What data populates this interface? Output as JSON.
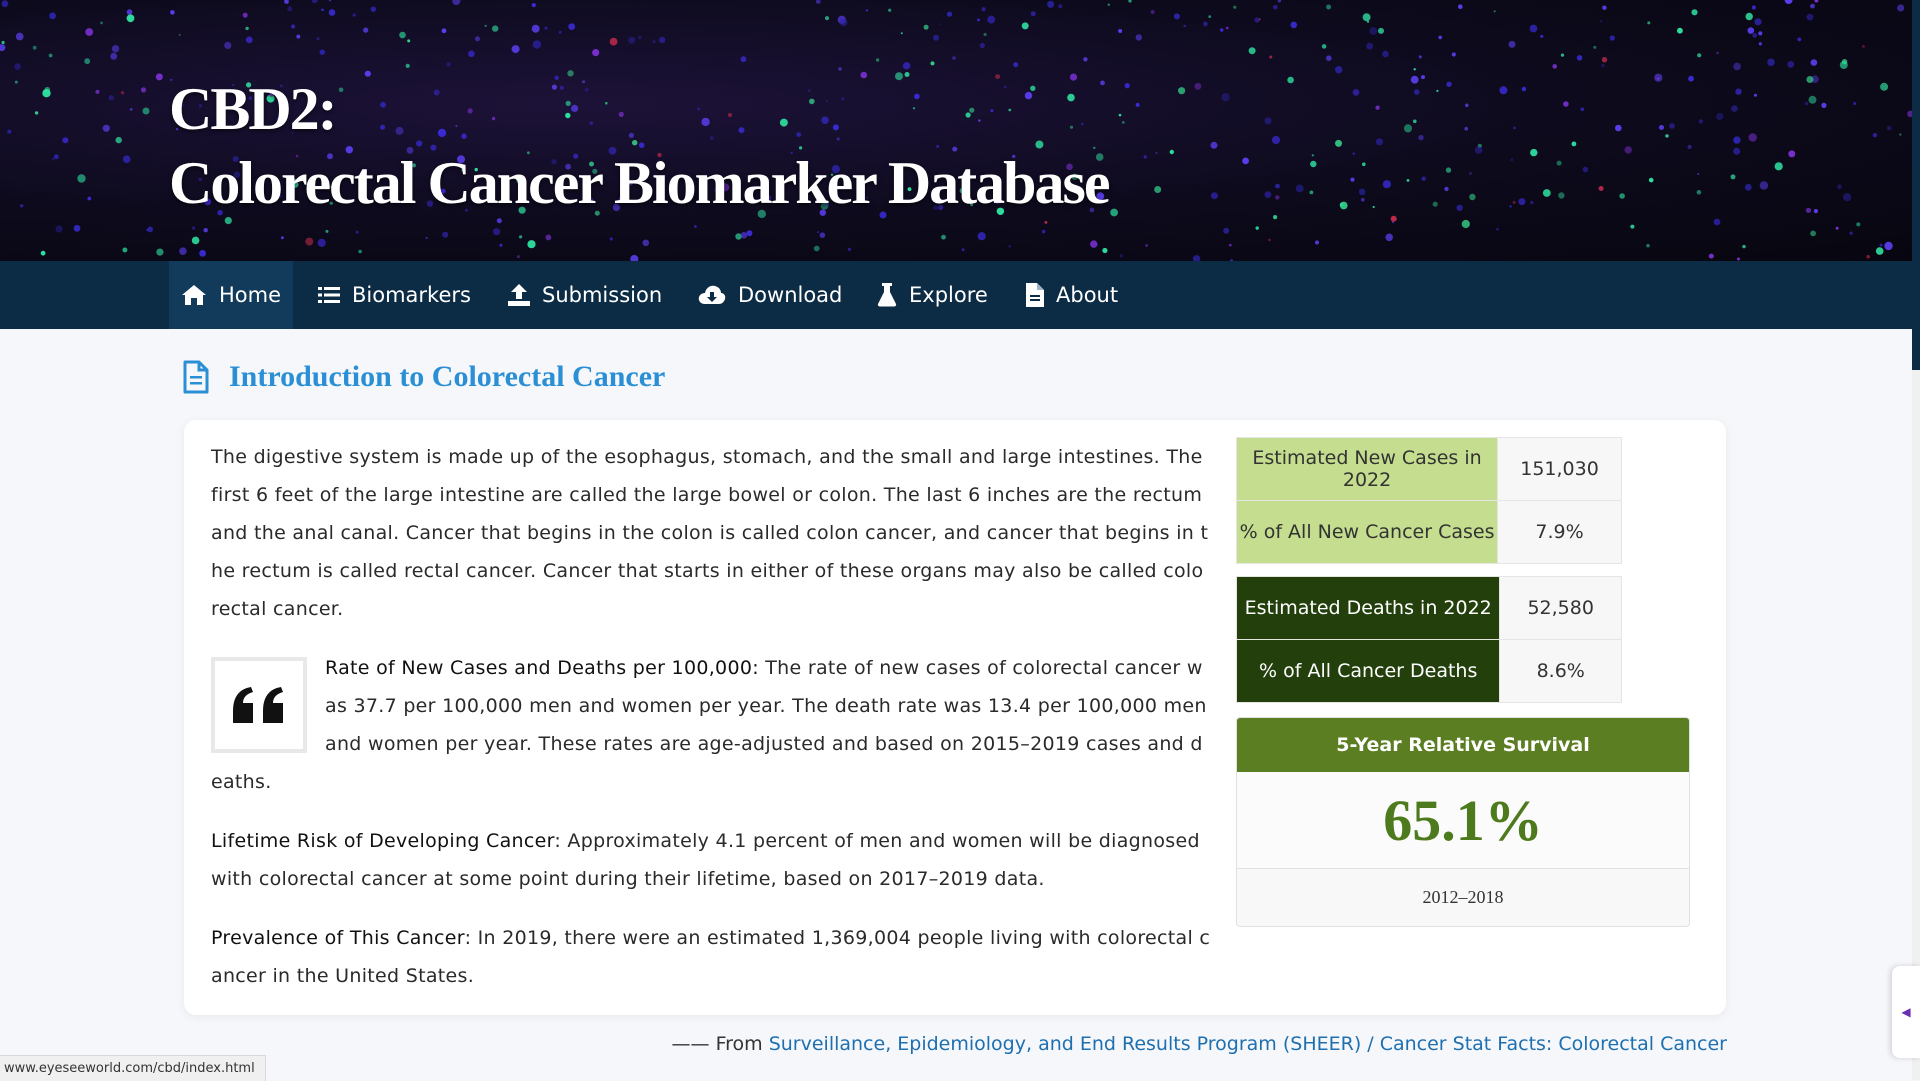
{
  "banner": {
    "title_line1": "CBD2:",
    "title_line2": "Colorectal Cancer Biomarker Database"
  },
  "nav": {
    "items": [
      {
        "label": "Home",
        "icon": "home-icon",
        "active": true
      },
      {
        "label": "Biomarkers",
        "icon": "list-icon"
      },
      {
        "label": "Submission",
        "icon": "upload-icon"
      },
      {
        "label": "Download",
        "icon": "cloud-download-icon"
      },
      {
        "label": "Explore",
        "icon": "flask-icon"
      },
      {
        "label": "About",
        "icon": "document-icon"
      }
    ]
  },
  "section": {
    "title": "Introduction to Colorectal Cancer",
    "icon": "document-outline-icon"
  },
  "intro": {
    "paragraph1": "The digestive system is made up of the esophagus, stomach, and the small and large intestines. The first 6 feet of the large intestine are called the large bowel or colon. The last 6 inches are the rectum and the anal canal. Cancer that begins in the colon is called colon cancer, and cancer that begins in the rectum is called rectal cancer. Cancer that starts in either of these organs may also be called colorectal cancer.",
    "rate_label": "Rate of New Cases and Deaths per 100,000:",
    "rate_text": " The rate of new cases of colorectal cancer was 37.7 per 100,000 men and women per year. The death rate was 13.4 per 100,000 men and women per year. These rates are age-adjusted and based on 2015–2019 cases and deaths.",
    "lifetime_label": "Lifetime Risk of Developing Cancer",
    "lifetime_text": ": Approximately 4.1 percent of men and women will be diagnosed with colorectal cancer at some point during their lifetime, based on 2017–2019 data.",
    "prevalence_label": "Prevalence of This Cancer",
    "prevalence_text": ": In 2019, there were an estimated 1,369,004 people living with colorectal cancer in the United States."
  },
  "stats": {
    "new_cases_label": "Estimated New Cases in 2022",
    "new_cases_value": "151,030",
    "pct_new_label": "% of All New Cancer Cases",
    "pct_new_value": "7.9%",
    "deaths_label": "Estimated Deaths in 2022",
    "deaths_value": "52,580",
    "pct_deaths_label": "% of All Cancer Deaths",
    "pct_deaths_value": "8.6%",
    "survival_title": "5-Year Relative Survival",
    "survival_value": "65.1%",
    "survival_years": "2012–2018"
  },
  "source": {
    "prefix": "—— From ",
    "link_text": "Surveillance, Epidemiology, and End Results Program (SHEER) / Cancer Stat Facts: Colorectal Cancer"
  },
  "status_bar": {
    "url": "www.eyeseeworld.com/cbd/index.html"
  },
  "colors": {
    "nav_bg": "#0c2b45",
    "title_blue": "#2a8fd4",
    "light_green": "#c4dd8e",
    "dark_green": "#233f0c",
    "survival_green": "#5b7e22"
  }
}
